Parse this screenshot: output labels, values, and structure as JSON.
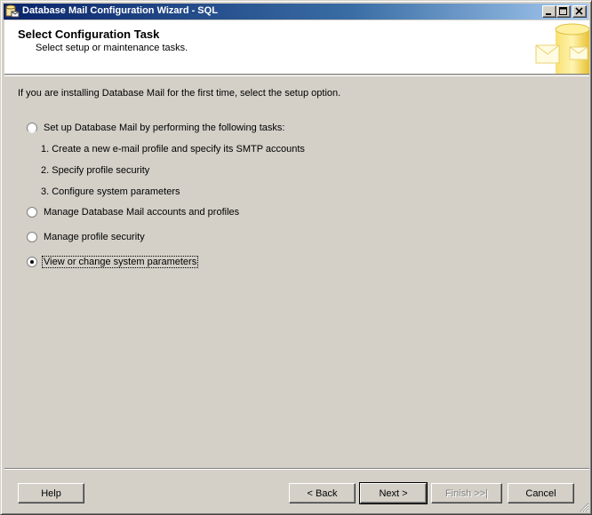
{
  "window": {
    "title": "Database Mail Configuration Wizard - SQL"
  },
  "header": {
    "title": "Select Configuration Task",
    "subtitle": "Select setup or maintenance tasks."
  },
  "intro_text": "If you are installing Database Mail for the first time, select the setup option.",
  "options": [
    {
      "label": "Set up Database Mail by performing the following tasks:",
      "selected": false
    },
    {
      "label": "Manage Database Mail accounts and profiles",
      "selected": false
    },
    {
      "label": "Manage profile security",
      "selected": false
    },
    {
      "label": "View or change system parameters",
      "selected": true
    }
  ],
  "setup_tasks": [
    "1. Create a new e-mail profile and specify its SMTP accounts",
    "2. Specify profile security",
    "3. Configure system parameters"
  ],
  "buttons": {
    "help": "Help",
    "back": "< Back",
    "next": "Next >",
    "finish": "Finish >>|",
    "cancel": "Cancel"
  },
  "colors": {
    "titlebar_start": "#0a246a",
    "titlebar_end": "#a6caf0",
    "dialog_bg": "#d4d0c8"
  }
}
